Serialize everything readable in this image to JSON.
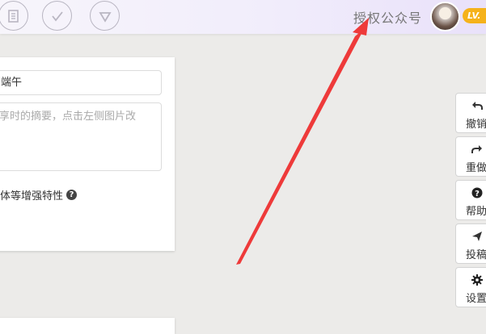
{
  "header": {
    "auth_link": "授权公众号",
    "level_badge": "LV.",
    "icons": [
      "document-icon",
      "check-icon",
      "triangle-icon"
    ]
  },
  "editor": {
    "title_value": "端午",
    "summary_placeholder": "享时的摘要，点击左侧图片改",
    "enhance_label": "体等增强特性"
  },
  "side_tools": [
    {
      "label": "撤销",
      "icon": "undo-icon"
    },
    {
      "label": "重做",
      "icon": "redo-icon"
    },
    {
      "label": "帮助",
      "icon": "help-icon"
    },
    {
      "label": "投稿",
      "icon": "send-icon"
    },
    {
      "label": "设置",
      "icon": "gear-icon"
    }
  ],
  "colors": {
    "badge": "#f5b21b",
    "annotation_arrow": "#ee3a3a",
    "icon_outline": "#b9b6c2"
  }
}
